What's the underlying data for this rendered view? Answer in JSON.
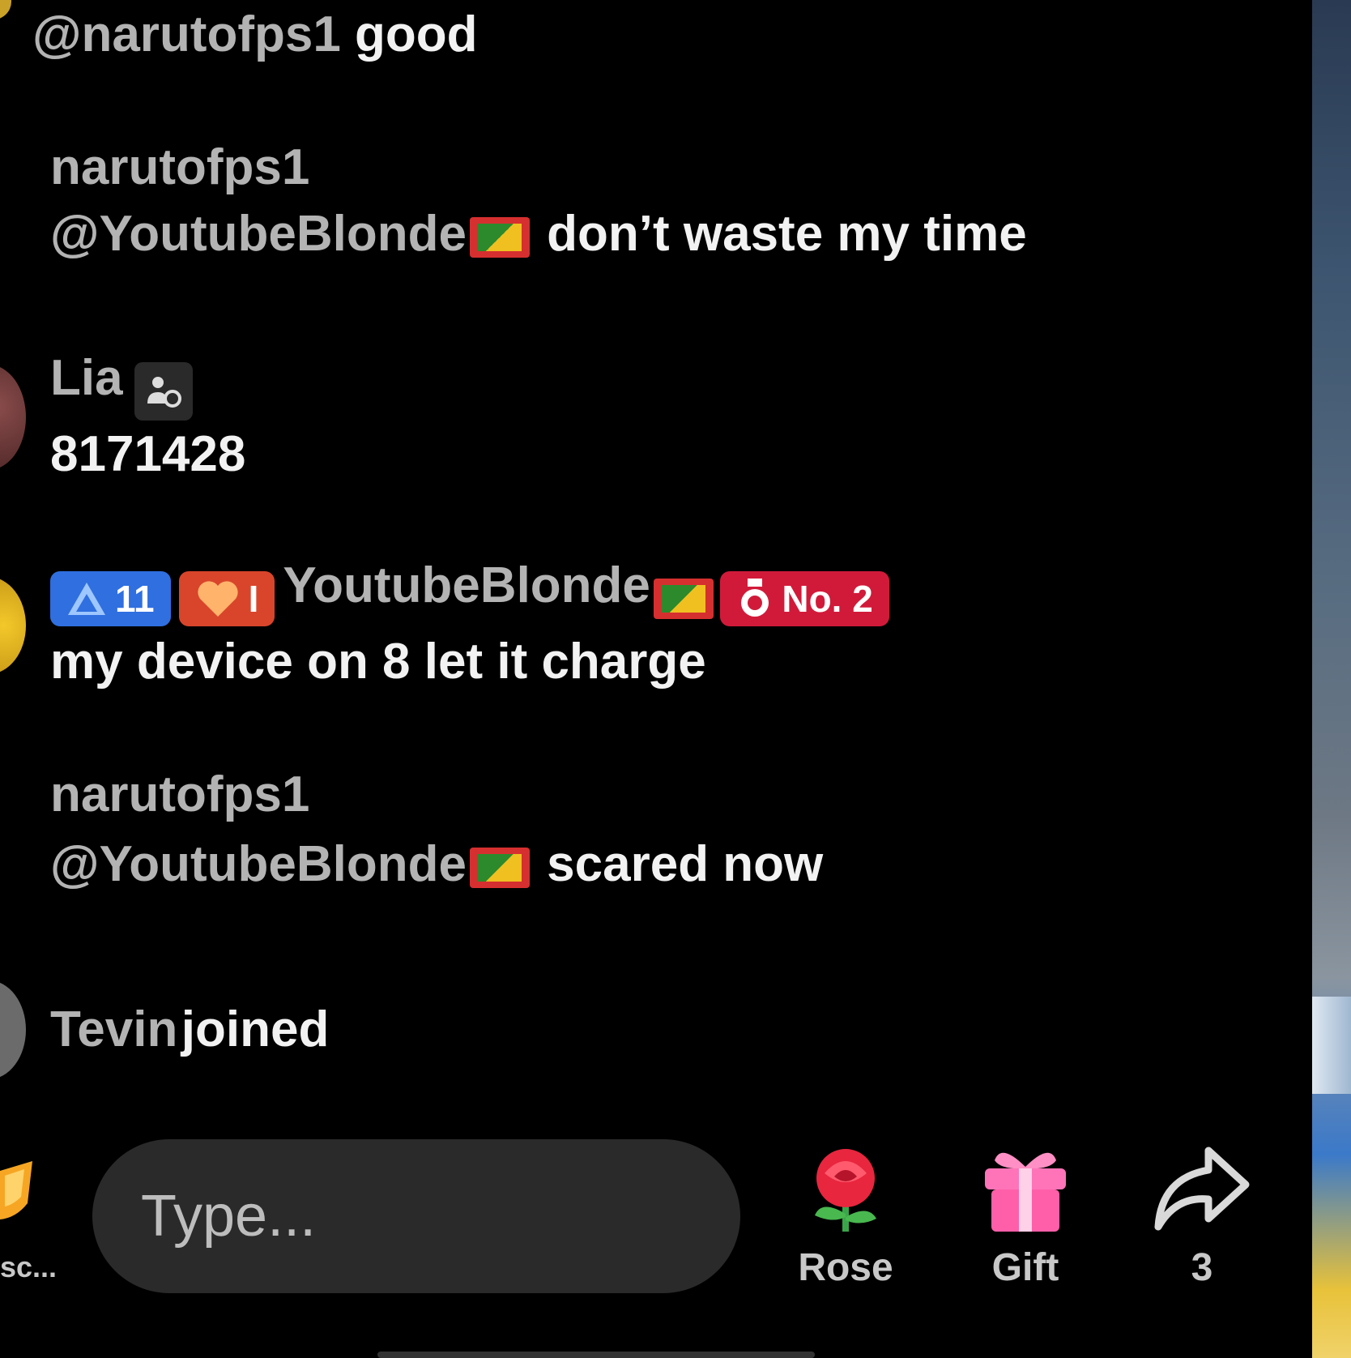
{
  "chat": {
    "partial_top": {
      "mention": "@narutofps1",
      "text": "good"
    },
    "messages": [
      {
        "username": "narutofps1",
        "mention": "@YoutubeBlonde",
        "text": "don’t waste my time"
      },
      {
        "username": "Lia",
        "text": "8171428"
      },
      {
        "username": "YoutubeBlonde",
        "level_badge": "11",
        "fan_badge": "I",
        "rank_badge": "No. 2",
        "text": "my device on 8 let it charge"
      },
      {
        "username": "narutofps1",
        "mention": "@YoutubeBlonde",
        "text": "scared now"
      }
    ],
    "join_event": {
      "username": "Tevin",
      "text": "joined"
    }
  },
  "bottom_bar": {
    "left_label": "sc...",
    "input_placeholder": "Type...",
    "rose_label": "Rose",
    "gift_label": "Gift",
    "share_count": "3"
  },
  "icons": {
    "flag": "grenada-flag-icon",
    "role": "moderator-icon",
    "rose": "rose-icon",
    "gift": "gift-icon",
    "share": "share-arrow-icon"
  }
}
